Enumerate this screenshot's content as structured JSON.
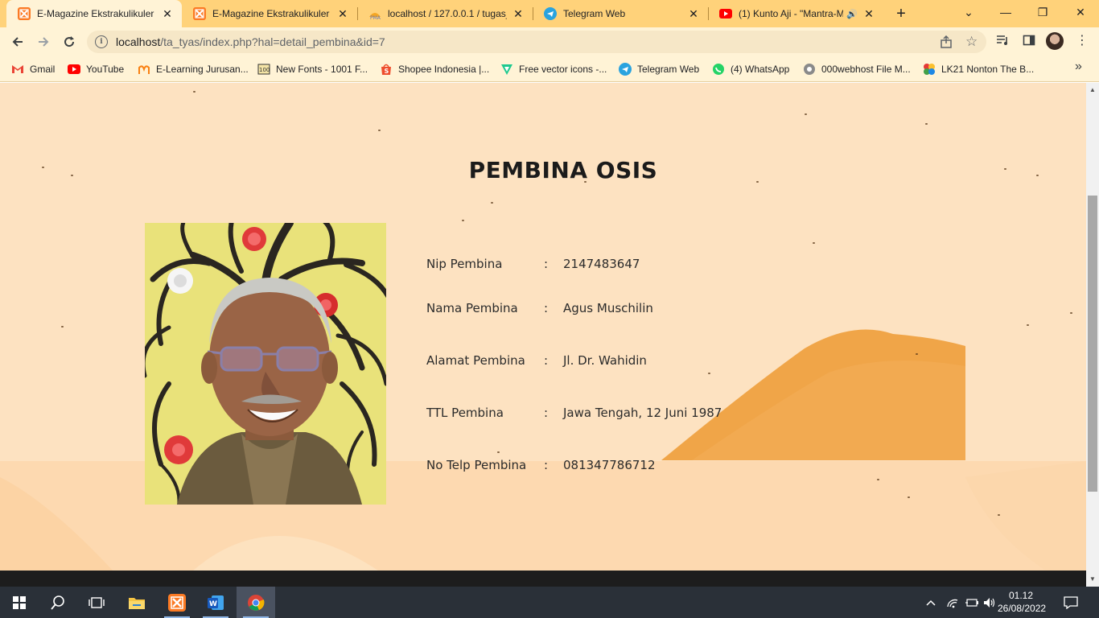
{
  "browser": {
    "tabs": [
      {
        "title": "E-Magazine Ekstrakulikuler",
        "favicon": "xampp-icon",
        "active": true
      },
      {
        "title": "E-Magazine Ekstrakulikuler",
        "favicon": "xampp-icon",
        "active": false
      },
      {
        "title": "localhost / 127.0.0.1 / tugas_",
        "favicon": "phpmyadmin-icon",
        "active": false
      },
      {
        "title": "Telegram Web",
        "favicon": "telegram-icon",
        "active": false
      },
      {
        "title": "(1) Kunto Aji - \"Mantra-M",
        "favicon": "youtube-icon",
        "active": false,
        "audio": true
      }
    ],
    "new_tab_label": "+",
    "url_host": "localhost",
    "url_path": "/ta_tyas/index.php?hal=detail_pembina&id=7",
    "bookmarks": [
      {
        "label": "Gmail",
        "icon": "gmail-icon"
      },
      {
        "label": "YouTube",
        "icon": "youtube-icon"
      },
      {
        "label": "E-Learning Jurusan...",
        "icon": "elearning-icon"
      },
      {
        "label": "New Fonts - 1001 F...",
        "icon": "fonts-icon"
      },
      {
        "label": "Shopee Indonesia |...",
        "icon": "shopee-icon"
      },
      {
        "label": "Free vector icons -...",
        "icon": "flaticon-icon"
      },
      {
        "label": "Telegram Web",
        "icon": "telegram-icon"
      },
      {
        "label": "(4) WhatsApp",
        "icon": "whatsapp-icon"
      },
      {
        "label": "000webhost File M...",
        "icon": "webhost-icon"
      },
      {
        "label": "LK21 Nonton The B...",
        "icon": "lk21-icon"
      }
    ]
  },
  "page": {
    "title": "PEMBINA OSIS",
    "photo": "person-photo",
    "fields": [
      {
        "label": "Nip Pembina",
        "value": "2147483647"
      },
      {
        "label": "Nama Pembina",
        "value": "Agus Muschilin"
      },
      {
        "label": "Alamat Pembina",
        "value": "Jl. Dr. Wahidin"
      },
      {
        "label": "TTL Pembina",
        "value": "Jawa Tengah, 12 Juni 1987"
      },
      {
        "label": "No Telp Pembina",
        "value": "081347786712"
      }
    ],
    "separator": ":"
  },
  "taskbar": {
    "time": "01.12",
    "date": "26/08/2022",
    "apps": [
      "start-icon",
      "search-icon",
      "task-view-icon",
      "file-explorer-icon",
      "xampp-icon",
      "word-icon",
      "chrome-icon"
    ]
  },
  "colors": {
    "tab_strip": "#ffd27a",
    "toolbar": "#fff3d6",
    "page_bg": "#fde2c1",
    "accent_orange": "#f0a23f",
    "taskbar": "#2a3038"
  }
}
